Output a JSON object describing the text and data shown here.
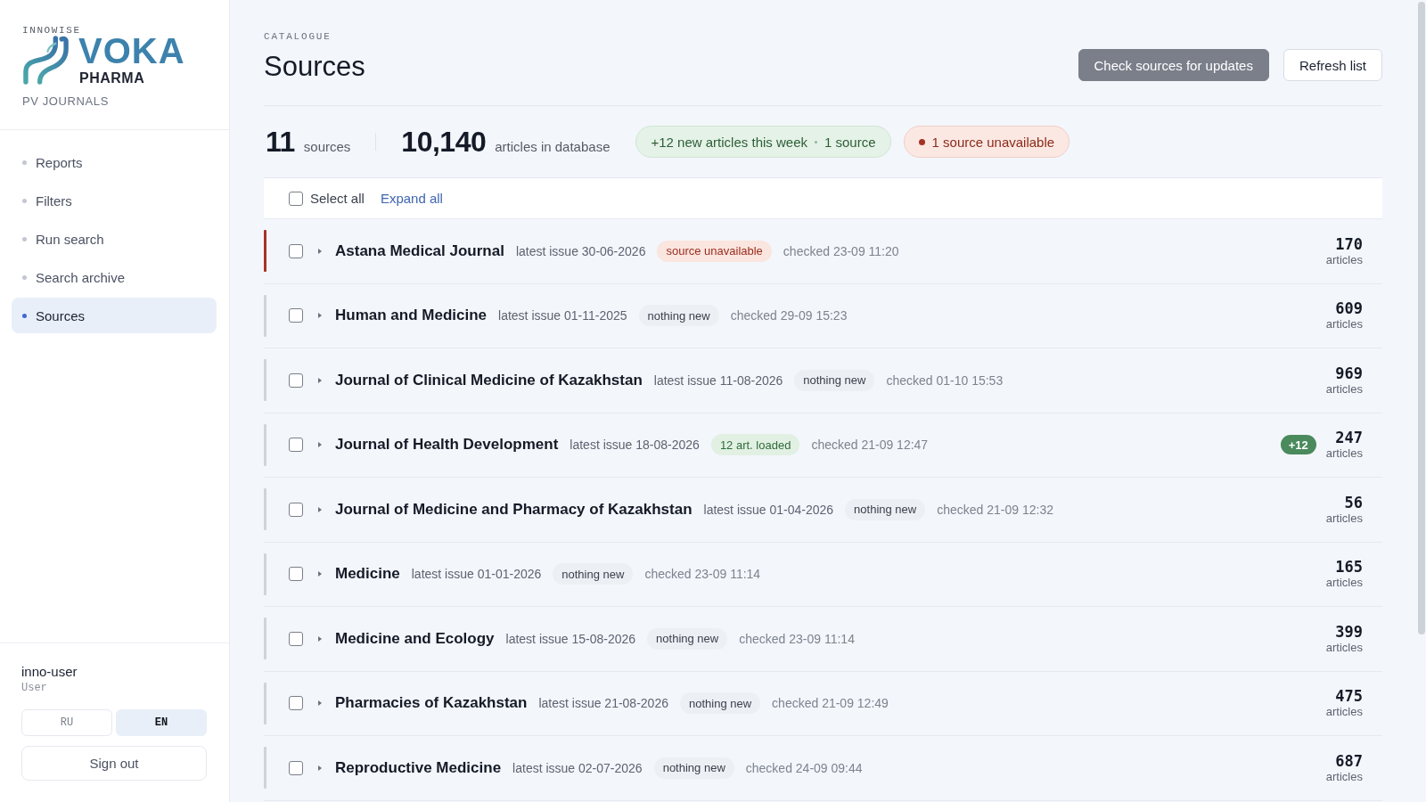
{
  "sidebar": {
    "brand": {
      "maker": "INNOWISE",
      "name": "VOKA",
      "subtitle": "PHARMA",
      "product": "PV JOURNALS"
    },
    "nav": [
      {
        "label": "Reports",
        "selected": false
      },
      {
        "label": "Filters",
        "selected": false
      },
      {
        "label": "Run search",
        "selected": false
      },
      {
        "label": "Search archive",
        "selected": false
      },
      {
        "label": "Sources",
        "selected": true
      }
    ],
    "user": {
      "name": "inno-user",
      "role": "User"
    },
    "languages": [
      {
        "label": "RU",
        "selected": false
      },
      {
        "label": "EN",
        "selected": true
      }
    ],
    "sign_out": "Sign out"
  },
  "header": {
    "eyebrow": "CATALOGUE",
    "title": "Sources",
    "buttons": [
      {
        "label": "Check sources for updates",
        "kind": "primary"
      },
      {
        "label": "Refresh list",
        "kind": "secondary"
      }
    ]
  },
  "stats": [
    {
      "value": "11",
      "label": "sources"
    },
    {
      "value": "10,140",
      "label": "articles in database"
    }
  ],
  "summary": {
    "new_articles": "+12 new articles this week",
    "new_sources": "1 source",
    "unavailable": "1 source unavailable"
  },
  "toolbar": {
    "select_all": {
      "label": "Select all",
      "checked": false
    },
    "expand_all": "Expand all"
  },
  "rows": [
    {
      "name": "Astana Medical Journal",
      "latest_issue": "latest issue 30-06-2026",
      "status": {
        "kind": "unavailable",
        "label": "source unavailable"
      },
      "checked_at": "checked 23-09 11:20",
      "count": "170",
      "count_label": "articles",
      "checked": false,
      "expanded": false
    },
    {
      "name": "Human and Medicine",
      "latest_issue": "latest issue 01-11-2025",
      "status": {
        "kind": "idle",
        "label": "nothing new"
      },
      "checked_at": "checked 29-09 15:23",
      "count": "609",
      "count_label": "articles",
      "checked": false,
      "expanded": false
    },
    {
      "name": "Journal of Clinical Medicine of Kazakhstan",
      "latest_issue": "latest issue 11-08-2026",
      "status": {
        "kind": "idle",
        "label": "nothing new"
      },
      "checked_at": "checked 01-10 15:53",
      "count": "969",
      "count_label": "articles",
      "checked": false,
      "expanded": false
    },
    {
      "name": "Journal of Health Development",
      "latest_issue": "latest issue 18-08-2026",
      "status": {
        "kind": "loaded",
        "label": "12 art. loaded"
      },
      "checked_at": "checked 21-09 12:47",
      "new_badge": "+12",
      "count": "247",
      "count_label": "articles",
      "checked": false,
      "expanded": false
    },
    {
      "name": "Journal of Medicine and Pharmacy of Kazakhstan",
      "latest_issue": "latest issue 01-04-2026",
      "status": {
        "kind": "idle",
        "label": "nothing new"
      },
      "checked_at": "checked 21-09 12:32",
      "count": "56",
      "count_label": "articles",
      "checked": false,
      "expanded": false
    },
    {
      "name": "Medicine",
      "latest_issue": "latest issue 01-01-2026",
      "status": {
        "kind": "idle",
        "label": "nothing new"
      },
      "checked_at": "checked 23-09 11:14",
      "count": "165",
      "count_label": "articles",
      "checked": false,
      "expanded": false
    },
    {
      "name": "Medicine and Ecology",
      "latest_issue": "latest issue 15-08-2026",
      "status": {
        "kind": "idle",
        "label": "nothing new"
      },
      "checked_at": "checked 23-09 11:14",
      "count": "399",
      "count_label": "articles",
      "checked": false,
      "expanded": false
    },
    {
      "name": "Pharmacies of Kazakhstan",
      "latest_issue": "latest issue 21-08-2026",
      "status": {
        "kind": "idle",
        "label": "nothing new"
      },
      "checked_at": "checked 21-09 12:49",
      "count": "475",
      "count_label": "articles",
      "checked": false,
      "expanded": false
    },
    {
      "name": "Reproductive Medicine",
      "latest_issue": "latest issue 02-07-2026",
      "status": {
        "kind": "idle",
        "label": "nothing new"
      },
      "checked_at": "checked 24-09 09:44",
      "count": "687",
      "count_label": "articles",
      "checked": false,
      "expanded": false
    }
  ]
}
